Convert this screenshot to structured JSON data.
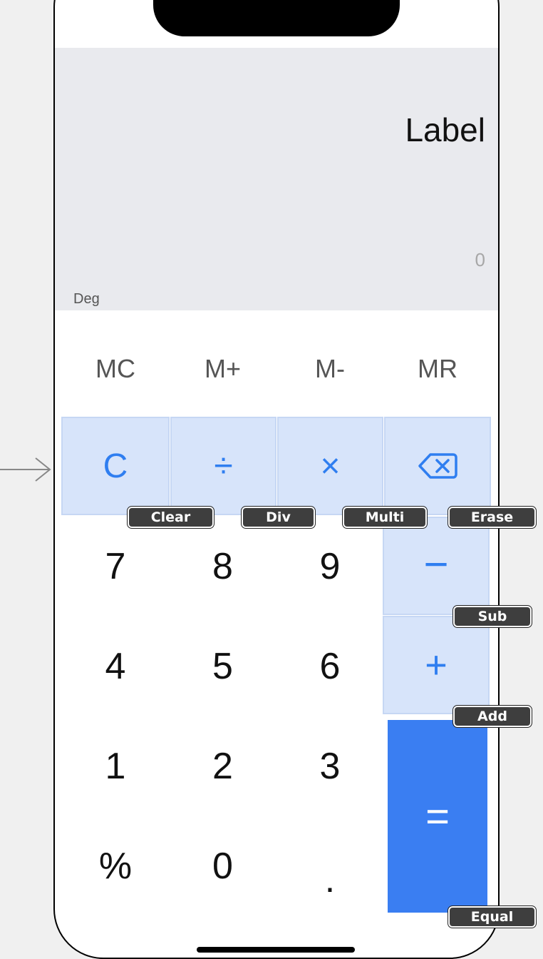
{
  "display": {
    "label": "Label",
    "result": "0",
    "mode": "Deg"
  },
  "memory_row": [
    "MC",
    "M+",
    "M-",
    "MR"
  ],
  "operators": {
    "clear": "C",
    "divide": "÷",
    "multiply": "×",
    "subtract": "−",
    "add": "+",
    "equal": "="
  },
  "digits": {
    "seven": "7",
    "eight": "8",
    "nine": "9",
    "four": "4",
    "five": "5",
    "six": "6",
    "one": "1",
    "two": "2",
    "three": "3",
    "percent": "%",
    "zero": "0",
    "dot": "."
  },
  "annotations": {
    "clear": "Clear",
    "div": "Div",
    "multi": "Multi",
    "erase": "Erase",
    "sub": "Sub",
    "add": "Add",
    "equal": "Equal"
  },
  "icons": {
    "erase": "backspace-icon",
    "entry": "arrow-right-icon"
  },
  "colors": {
    "accent": "#2f7ef0",
    "operator_bg": "#d7e4fa",
    "equal_bg": "#3a7ef2",
    "display_bg": "#e9eaee",
    "canvas_bg": "#f0f0f0"
  }
}
